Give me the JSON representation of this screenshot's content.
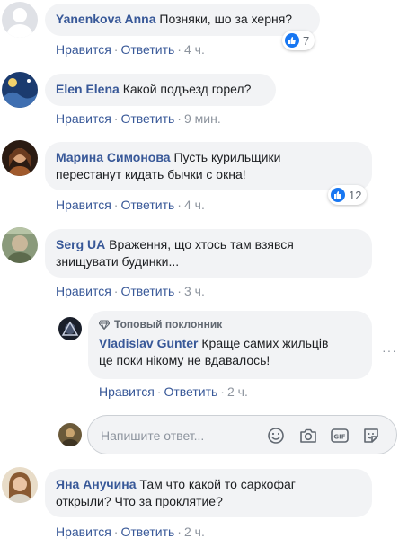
{
  "comments": [
    {
      "author": "Yanenkova Anna",
      "text": "Позняки, шо за херня?",
      "like_label": "Нравится",
      "reply_label": "Ответить",
      "time": "4 ч.",
      "reactions": "7"
    },
    {
      "author": "Elen Elena",
      "text": "Какой подъезд горел?",
      "like_label": "Нравится",
      "reply_label": "Ответить",
      "time": "9 мин."
    },
    {
      "author": "Марина Симонова",
      "text_line1": "Пусть курильщики",
      "text_line2": "перестанут кидать бычки с окна!",
      "like_label": "Нравится",
      "reply_label": "Ответить",
      "time": "4 ч.",
      "reactions": "12"
    },
    {
      "author": "Serg UA",
      "text_line1": "Враження, що хтось там взявся",
      "text_line2": "знищувати будинки...",
      "like_label": "Нравится",
      "reply_label": "Ответить",
      "time": "3 ч."
    },
    {
      "author": "Яна Анучина",
      "text_line1": "Там что какой то саркофаг",
      "text_line2": "открыли? Что за проклятие?",
      "like_label": "Нравится",
      "reply_label": "Ответить",
      "time": "2 ч."
    }
  ],
  "reply": {
    "badge": "Топовый поклонник",
    "author": "Vladislav Gunter",
    "text_line1": "Краще самих жильців",
    "text_line2": "це поки нікому не вдавалось!",
    "like_label": "Нравится",
    "reply_label": "Ответить",
    "time": "2 ч."
  },
  "reply_box": {
    "placeholder": "Напишите ответ...",
    "icons": [
      "emoji-icon",
      "camera-icon",
      "gif-icon",
      "sticker-icon"
    ]
  },
  "more_menu": "···",
  "separator": "·",
  "colors": {
    "link": "#385898",
    "bubble": "#f2f3f5",
    "like": "#1877f2",
    "meta": "#8d949e"
  }
}
